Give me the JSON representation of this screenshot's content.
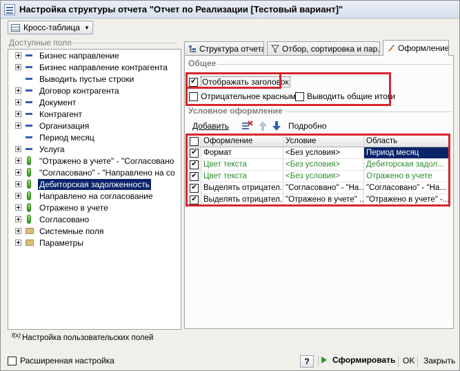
{
  "window": {
    "title": "Настройка структуры отчета \"Отчет по Реализации [Тестовый вариант]\""
  },
  "toolbar": {
    "layout_button": "Кросс-таблица"
  },
  "fields_panel": {
    "caption": "Доступные поля",
    "items": [
      {
        "label": "Бизнес направление",
        "kind": "field",
        "expandable": true
      },
      {
        "label": "Бизнес направление контрагента",
        "kind": "field",
        "expandable": true
      },
      {
        "label": "Выводить пустые строки",
        "kind": "field",
        "expandable": false
      },
      {
        "label": "Договор контрагента",
        "kind": "field",
        "expandable": true
      },
      {
        "label": "Документ",
        "kind": "field",
        "expandable": true
      },
      {
        "label": "Контрагент",
        "kind": "field",
        "expandable": true
      },
      {
        "label": "Организация",
        "kind": "field",
        "expandable": true
      },
      {
        "label": "Период месяц",
        "kind": "field",
        "expandable": false
      },
      {
        "label": "Услуга",
        "kind": "field",
        "expandable": true
      },
      {
        "label": "\"Отражено в учете\" - \"Согласовано",
        "kind": "resource",
        "expandable": true
      },
      {
        "label": "\"Согласовано\" - \"Направлено на со",
        "kind": "resource",
        "expandable": true
      },
      {
        "label": "Дебиторская задолженность",
        "kind": "resource",
        "expandable": true,
        "selected": true
      },
      {
        "label": "Направлено на согласование",
        "kind": "resource",
        "expandable": true
      },
      {
        "label": "Отражено в учете",
        "kind": "resource",
        "expandable": true
      },
      {
        "label": "Согласовано",
        "kind": "resource",
        "expandable": true
      },
      {
        "label": "Системные поля",
        "kind": "folder",
        "expandable": true
      },
      {
        "label": "Параметры",
        "kind": "folder",
        "expandable": true
      }
    ],
    "custom_fields_label": "Настройка пользовательских полей",
    "custom_fields_icon": "f(x)"
  },
  "tabs": [
    {
      "label": "Структура отчета",
      "icon": "structure-icon"
    },
    {
      "label": "Отбор, сортировка и пар...",
      "icon": "filter-icon"
    },
    {
      "label": "Оформление",
      "icon": "brush-icon",
      "active": true
    }
  ],
  "general": {
    "caption": "Общее",
    "show_header": {
      "label": "Отображать заголовок",
      "checked": true
    },
    "negative_red": {
      "label": "Отрицательное красным",
      "checked": false
    },
    "show_totals": {
      "label": "Выводить общие итоги",
      "checked": false
    }
  },
  "conditional": {
    "caption": "Условное оформление",
    "add_label": "Добавить",
    "details_label": "Подробно",
    "columns": [
      "Оформление",
      "Условие",
      "Область"
    ],
    "rows": [
      {
        "checked": true,
        "format": "Формат",
        "condition": "<Без условия>",
        "area": "Период месяц",
        "green": false,
        "area_selected": true
      },
      {
        "checked": true,
        "format": "Цвет текста",
        "condition": "<Без условия>",
        "area": "Дебиторская задол...",
        "green": true
      },
      {
        "checked": true,
        "format": "Цвет текста",
        "condition": "<Без условия>",
        "area": "Отражено в учете",
        "green": true
      },
      {
        "checked": true,
        "format": "Выделять отрицател...",
        "condition": "\"Согласовано\" - \"На...",
        "area": "\"Согласовано\" - \"На...",
        "green": false
      },
      {
        "checked": true,
        "format": "Выделять отрицател...",
        "condition": "\"Отражено в учете\" ...",
        "area": "\"Отражено в учете\" -...",
        "green": false
      }
    ]
  },
  "footer": {
    "advanced_label": "Расширенная настройка",
    "help_label": "?",
    "run_label": "Сформировать",
    "ok_label": "OK",
    "close_label": "Закрыть"
  },
  "colors": {
    "selection": "#0a246a",
    "highlight_frame": "#d8262b",
    "green_text": "#2e8b2e"
  }
}
